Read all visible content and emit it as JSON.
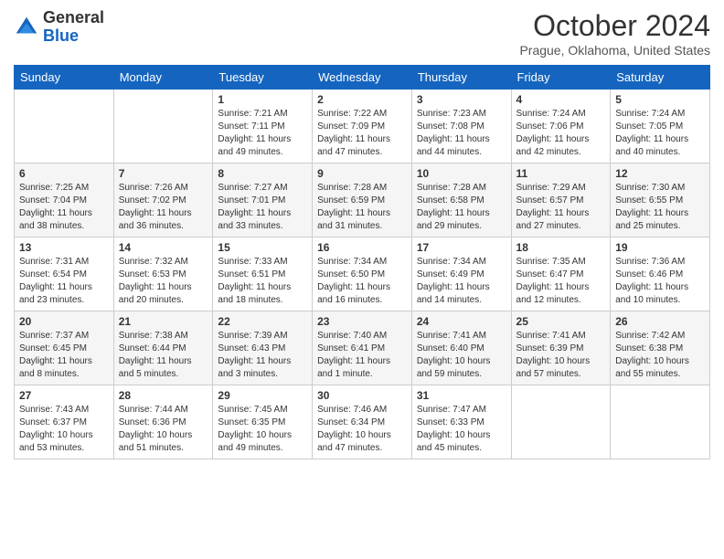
{
  "header": {
    "logo": {
      "line1": "General",
      "line2": "Blue"
    },
    "title": "October 2024",
    "location": "Prague, Oklahoma, United States"
  },
  "weekdays": [
    "Sunday",
    "Monday",
    "Tuesday",
    "Wednesday",
    "Thursday",
    "Friday",
    "Saturday"
  ],
  "weeks": [
    [
      {
        "day": "",
        "info": ""
      },
      {
        "day": "",
        "info": ""
      },
      {
        "day": "1",
        "info": "Sunrise: 7:21 AM\nSunset: 7:11 PM\nDaylight: 11 hours and 49 minutes."
      },
      {
        "day": "2",
        "info": "Sunrise: 7:22 AM\nSunset: 7:09 PM\nDaylight: 11 hours and 47 minutes."
      },
      {
        "day": "3",
        "info": "Sunrise: 7:23 AM\nSunset: 7:08 PM\nDaylight: 11 hours and 44 minutes."
      },
      {
        "day": "4",
        "info": "Sunrise: 7:24 AM\nSunset: 7:06 PM\nDaylight: 11 hours and 42 minutes."
      },
      {
        "day": "5",
        "info": "Sunrise: 7:24 AM\nSunset: 7:05 PM\nDaylight: 11 hours and 40 minutes."
      }
    ],
    [
      {
        "day": "6",
        "info": "Sunrise: 7:25 AM\nSunset: 7:04 PM\nDaylight: 11 hours and 38 minutes."
      },
      {
        "day": "7",
        "info": "Sunrise: 7:26 AM\nSunset: 7:02 PM\nDaylight: 11 hours and 36 minutes."
      },
      {
        "day": "8",
        "info": "Sunrise: 7:27 AM\nSunset: 7:01 PM\nDaylight: 11 hours and 33 minutes."
      },
      {
        "day": "9",
        "info": "Sunrise: 7:28 AM\nSunset: 6:59 PM\nDaylight: 11 hours and 31 minutes."
      },
      {
        "day": "10",
        "info": "Sunrise: 7:28 AM\nSunset: 6:58 PM\nDaylight: 11 hours and 29 minutes."
      },
      {
        "day": "11",
        "info": "Sunrise: 7:29 AM\nSunset: 6:57 PM\nDaylight: 11 hours and 27 minutes."
      },
      {
        "day": "12",
        "info": "Sunrise: 7:30 AM\nSunset: 6:55 PM\nDaylight: 11 hours and 25 minutes."
      }
    ],
    [
      {
        "day": "13",
        "info": "Sunrise: 7:31 AM\nSunset: 6:54 PM\nDaylight: 11 hours and 23 minutes."
      },
      {
        "day": "14",
        "info": "Sunrise: 7:32 AM\nSunset: 6:53 PM\nDaylight: 11 hours and 20 minutes."
      },
      {
        "day": "15",
        "info": "Sunrise: 7:33 AM\nSunset: 6:51 PM\nDaylight: 11 hours and 18 minutes."
      },
      {
        "day": "16",
        "info": "Sunrise: 7:34 AM\nSunset: 6:50 PM\nDaylight: 11 hours and 16 minutes."
      },
      {
        "day": "17",
        "info": "Sunrise: 7:34 AM\nSunset: 6:49 PM\nDaylight: 11 hours and 14 minutes."
      },
      {
        "day": "18",
        "info": "Sunrise: 7:35 AM\nSunset: 6:47 PM\nDaylight: 11 hours and 12 minutes."
      },
      {
        "day": "19",
        "info": "Sunrise: 7:36 AM\nSunset: 6:46 PM\nDaylight: 11 hours and 10 minutes."
      }
    ],
    [
      {
        "day": "20",
        "info": "Sunrise: 7:37 AM\nSunset: 6:45 PM\nDaylight: 11 hours and 8 minutes."
      },
      {
        "day": "21",
        "info": "Sunrise: 7:38 AM\nSunset: 6:44 PM\nDaylight: 11 hours and 5 minutes."
      },
      {
        "day": "22",
        "info": "Sunrise: 7:39 AM\nSunset: 6:43 PM\nDaylight: 11 hours and 3 minutes."
      },
      {
        "day": "23",
        "info": "Sunrise: 7:40 AM\nSunset: 6:41 PM\nDaylight: 11 hours and 1 minute."
      },
      {
        "day": "24",
        "info": "Sunrise: 7:41 AM\nSunset: 6:40 PM\nDaylight: 10 hours and 59 minutes."
      },
      {
        "day": "25",
        "info": "Sunrise: 7:41 AM\nSunset: 6:39 PM\nDaylight: 10 hours and 57 minutes."
      },
      {
        "day": "26",
        "info": "Sunrise: 7:42 AM\nSunset: 6:38 PM\nDaylight: 10 hours and 55 minutes."
      }
    ],
    [
      {
        "day": "27",
        "info": "Sunrise: 7:43 AM\nSunset: 6:37 PM\nDaylight: 10 hours and 53 minutes."
      },
      {
        "day": "28",
        "info": "Sunrise: 7:44 AM\nSunset: 6:36 PM\nDaylight: 10 hours and 51 minutes."
      },
      {
        "day": "29",
        "info": "Sunrise: 7:45 AM\nSunset: 6:35 PM\nDaylight: 10 hours and 49 minutes."
      },
      {
        "day": "30",
        "info": "Sunrise: 7:46 AM\nSunset: 6:34 PM\nDaylight: 10 hours and 47 minutes."
      },
      {
        "day": "31",
        "info": "Sunrise: 7:47 AM\nSunset: 6:33 PM\nDaylight: 10 hours and 45 minutes."
      },
      {
        "day": "",
        "info": ""
      },
      {
        "day": "",
        "info": ""
      }
    ]
  ]
}
